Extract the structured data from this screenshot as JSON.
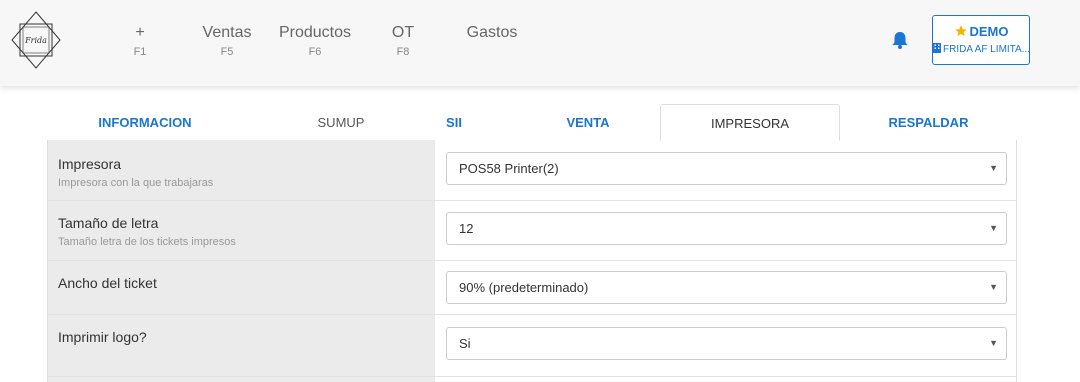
{
  "header": {
    "logo_text": "Frida",
    "nav": [
      {
        "label": "+",
        "key": "F1"
      },
      {
        "label": "Ventas",
        "key": "F5"
      },
      {
        "label": "Productos",
        "key": "F6"
      },
      {
        "label": "OT",
        "key": "F8"
      },
      {
        "label": "Gastos",
        "key": ""
      }
    ],
    "account": {
      "title": "DEMO",
      "company": "FRIDA AF LIMITA..."
    },
    "icons": {
      "bell": "bell-icon",
      "star": "star-icon",
      "building": "building-icon"
    },
    "accent_color": "#1976d2"
  },
  "tabs": [
    {
      "label": "INFORMACION"
    },
    {
      "label": "SUMUP"
    },
    {
      "label": "SII"
    },
    {
      "label": "VENTA"
    },
    {
      "label": "IMPRESORA"
    },
    {
      "label": "RESPALDAR"
    }
  ],
  "active_tab": "IMPRESORA",
  "settings": [
    {
      "title": "Impresora",
      "subtitle": "Impresora con la que trabajaras",
      "value": "POS58 Printer(2)"
    },
    {
      "title": "Tamaño de letra",
      "subtitle": "Tamaño letra de los tickets impresos",
      "value": "12"
    },
    {
      "title": "Ancho del ticket",
      "subtitle": "",
      "value": "90% (predeterminado)"
    },
    {
      "title": "Imprimir logo?",
      "subtitle": "",
      "value": "Si"
    }
  ]
}
